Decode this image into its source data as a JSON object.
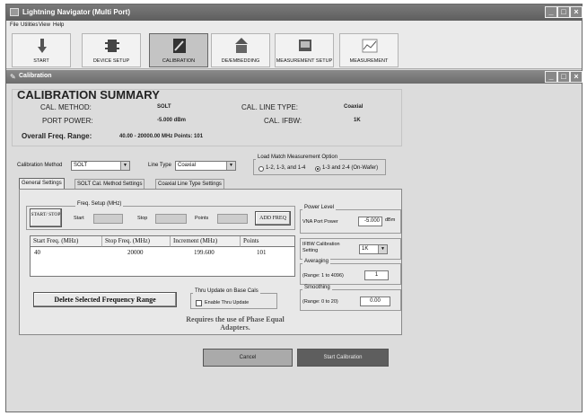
{
  "window": {
    "title": "Lightning Navigator (Multi Port)",
    "controls": [
      "_",
      "□",
      "×"
    ]
  },
  "menu": [
    "File",
    "Utilities",
    "View",
    "Help"
  ],
  "toolbar": [
    {
      "label": "START",
      "icon": "start-icon"
    },
    {
      "label": "DEVICE SETUP",
      "icon": "device-setup-icon"
    },
    {
      "label": "CALIBRATION",
      "icon": "calibration-icon",
      "active": true
    },
    {
      "label": "DE/EMBEDDING",
      "icon": "de-embedding-icon"
    },
    {
      "label": "MEASUREMENT SETUP",
      "icon": "measurement-setup-icon"
    },
    {
      "label": "MEASUREMENT",
      "icon": "measurement-icon"
    }
  ],
  "subwindow": {
    "title": "Calibration"
  },
  "summary": {
    "title": "CALIBRATION SUMMARY",
    "cal_method_label": "CAL. METHOD:",
    "cal_method_value": "SOLT",
    "cal_line_type_label": "CAL. LINE TYPE:",
    "cal_line_type_value": "Coaxial",
    "port_power_label": "PORT POWER:",
    "port_power_value": "-5.000 dBm",
    "cal_ifbw_label": "CAL. IFBW:",
    "cal_ifbw_value": "1K",
    "freq_range_label": "Overall Freq. Range:",
    "freq_range_value": "40.00 - 20000.00 MHz Points: 101"
  },
  "method": {
    "label": "Calibration Method",
    "value": "SOLT",
    "line_type_label": "Line Type",
    "line_type_value": "Coaxial"
  },
  "load_match": {
    "legend": "Load Match Measurement Option",
    "option1": "1-2, 1-3, and 1-4",
    "option2": "1-3 and 2-4 (On-Wafer)",
    "selected": 2
  },
  "tabs": [
    "General Settings",
    "SOLT Cal. Method Settings",
    "Coaxial Line Type Settings"
  ],
  "freq_setup": {
    "legend": "Freq. Setup (MHz)",
    "start_stop_btn": "START/ STOP",
    "start_label": "Start",
    "stop_label": "Stop",
    "points_label": "Points",
    "add_btn": "ADD FREQ"
  },
  "freq_table": {
    "headers": [
      "Start Freq. (MHz)",
      "Stop Freq. (MHz)",
      "Increment (MHz)",
      "Points"
    ],
    "rows": [
      [
        "40",
        "20000",
        "199.600",
        "101"
      ]
    ]
  },
  "power_level": {
    "legend": "Power Level",
    "label": "VNA Port Power",
    "value": "-5.000",
    "unit": "dBm"
  },
  "ifbw": {
    "label": "IFBW Calibration Setting",
    "value": "1K"
  },
  "averaging": {
    "legend": "Averaging",
    "label": "(Range: 1 to 4096)",
    "value": "1"
  },
  "smoothing": {
    "legend": "Smoothing",
    "label": "(Range: 0 to 20)",
    "value": "0.00"
  },
  "delete_btn": "Delete Selected Frequency Range",
  "thru_update": {
    "legend": "Thru Update on Base Cals",
    "checkbox_label": "Enable Thru Update"
  },
  "note": "Requires the use of Phase Equal Adapters.",
  "cancel_btn": "Cancel",
  "start_cal_btn": "Start Calibration"
}
